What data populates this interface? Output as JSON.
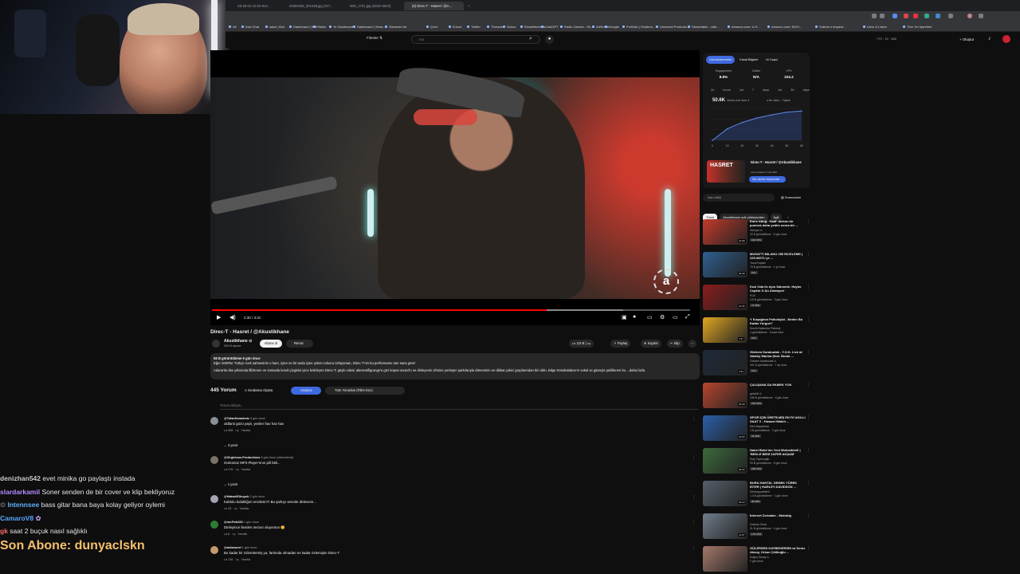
{
  "stream": {
    "chat": [
      {
        "user": "denizhan542",
        "color": "#c8c8c8",
        "msg": "evet minika go paylaştı instada"
      },
      {
        "user": "slardarkamil",
        "color": "#b78cff",
        "msg": "Soner senden de bir cover ve klip bekliyoruz"
      },
      {
        "user": "Intennsee",
        "color": "#5fb0ff",
        "msg": "bass gitar bana baya kolay geliyor oylemi"
      },
      {
        "user": "CamaroV8",
        "color": "#58a6ff",
        "msg": ""
      },
      {
        "user": "gk",
        "color": "#ff6b6b",
        "msg": "saat 2 buçuk nasıl sağlıklı"
      }
    ],
    "last_sub": "Son Abone: dunyaclskn",
    "chat_user_prefix": "⊙"
  },
  "browser": {
    "tabs": [
      {
        "label": "-23-29-02-12-01-813..."
      },
      {
        "label": "20250328_001238.jpg (317..."
      },
      {
        "label": "IMG_1701.jpg (4032×3024)"
      },
      {
        "label": "(6) Direc-T - Hasret / @A..."
      }
    ],
    "bookmarks": [
      "Alt",
      "Kick Chat",
      "sasa | Kick",
      "Dashboard | Kick",
      "Twitch",
      "Ye Dashboard",
      "Dashboard | Strea...",
      "Streamer Ad",
      "Çevri",
      "iCloud",
      "Twitter",
      "Threads",
      "Ücüzu",
      "Einstellements",
      "ChatGPT",
      "Radio Garden - Kh...",
      "AdSense",
      "Google",
      "Portfolio | Shutters...",
      "Universal Products...",
      "Streamable - vide...",
      "Amazon.com: U.S...",
      "Amazon.com: NCIV...",
      "Submit a request...",
      "Drive & Listen",
      "Tüm Yer İşaretleri"
    ]
  },
  "yt": {
    "filters_label": "Filtreler ⇅",
    "search_placeholder": "Ara",
    "create_label": "+ Oluştur",
    "stats": "779 · 15 · 465"
  },
  "video": {
    "title": "Direc-T - Hasret / @Akustikhane",
    "time": "2:30 / 3:31",
    "progress": 0.7,
    "buffered": 0.86,
    "watermark": "a",
    "channel": "Akustikhane ⊙",
    "subs": "390 B abone",
    "subscribe_label": "Abone ol",
    "join_label": "Remix",
    "likes": "3,9 B",
    "share_label": "Paylaş",
    "save_label": "Kaydet",
    "clip_label": "Klip",
    "desc_meta": "58 B görüntüleme  6 gün önce",
    "desc_line1": "Eğer 2000'ler Türkçe rock sahnesinin o ham, içten ve bir anda içine çeken ruhunu özlüyorsan, Direc-T'nin bu performansı tam sana göre!",
    "desc_line2": "Adana'da lise yıllarında filizlenen ve zamanla kendi çizgisini iyice belirleyen Direc-T; güçlü vokal, alternatif/grunge'a göz kırpan sound'u ve dinleyenin zihnine yerleşen şarkılarıyla döneminin en dikkat çekici gruplarından biri oldu. Bilge Kösebalaban'ın vokal ve gitarıyla şekillenen bu ...daha fazla"
  },
  "comments": {
    "count": "445 Yorum",
    "sort_label": "Sıralama ölçütü",
    "analyze_chip": "Analyze",
    "filter_chip": "Tüm Yorumlar (Filtre Enc)",
    "add_placeholder": "Yorum ekleyin...",
    "items": [
      {
        "author": "@TufanKaradeniz",
        "time": "5 gün önce",
        "text": "oldlarsi gözü yaşlı, yeniler hav hav hav",
        "likes": "406",
        "reply": "Yanıtla",
        "replies": "3 yanıt",
        "avatar": "#8a8f98"
      },
      {
        "author": "@Virginious.Productions",
        "time": "5 gün önce (düzenlendi)",
        "text": "Günümüz MP3 Player'ımın pili bitti...",
        "likes": "176",
        "reply": "Yanıtla",
        "replies": "1 yanıt",
        "avatar": "#7a7468"
      },
      {
        "author": "@Hakan5Obuyuk",
        "time": "2 gün önce",
        "text": "Kablolu kulaklığım nerdesin?! Bu şarkıyı senınle dinlecem...",
        "likes": "15",
        "reply": "Yanıtla",
        "replies": "",
        "avatar": "#a4a4b0"
      },
      {
        "author": "@nurFolk301",
        "time": "1 gün önce",
        "text": "Dinleyince liseden mezun oluyorsun 😊",
        "likes": "8",
        "reply": "Yanıtla",
        "replies": "",
        "avatar": "#2e7d32"
      },
      {
        "author": "@ardasunel",
        "time": "1 gün önce",
        "text": "Bu kadar bir özlemlermiş ya, farkında olmadan ne kadar özlemişim Direc-T",
        "likes": "136",
        "reply": "Yanıtla",
        "replies": "",
        "avatar": "#c49a6c"
      }
    ]
  },
  "extension": {
    "tabs": [
      "Görüntülenmeler",
      "Kanal Bilgileri",
      "AI Capsl"
    ],
    "metrics": [
      {
        "label": "Engagement",
        "value": "8.8%"
      },
      {
        "label": "Outlier",
        "value": "N/A"
      },
      {
        "label": "VPH",
        "value": "234.2"
      }
    ],
    "periods": "24 hours 1st 7 days 1st 30 days",
    "big_views": "50.6K",
    "views_over": "Views over time ▾",
    "opts": "● Bu video  ○ Tipikal",
    "thumb_text": "HASRET",
    "video_title": "Direc-T - Hasret / @Akustikhane",
    "video_sub": "Last Updated: 9.04.2025",
    "similar_btn": "See similar thumbnails →",
    "chart_data": {
      "type": "line",
      "x": [
        0,
        10,
        20,
        30,
        40,
        50,
        60
      ],
      "values": [
        0,
        18,
        28,
        35,
        40,
        44,
        46
      ],
      "ylim": [
        0,
        50
      ],
      "xticks": [
        "0",
        "10",
        "20",
        "30",
        "40",
        "50",
        "60"
      ]
    }
  },
  "sidebar": {
    "ask_placeholder": "Ask vidIQ",
    "summarize_label": "Summarize",
    "chips": [
      "Tümü",
      "Akustikhane adlı yükleyiciden",
      "İlgili"
    ],
    "recs": [
      {
        "title": "Emre Altuğ: 'Hadi' derken bir pumruk daha yedim sonra bir ...",
        "channel": "Hürriyet ⊙",
        "meta": "22 B görüntüleme · 5 gün önce",
        "dur": "21:09",
        "badges": [
          "192 VPH"
        ],
        "thumb": "#c43b2c"
      },
      {
        "title": "MUSATTI MILANO 250 İNCELEME | 225.000TL'ye ...",
        "channel": "Yusuf Kaplan",
        "meta": "79 B görüntüleme · 1 yıl önce",
        "dur": "20:49",
        "badges": [
          "0.5x"
        ],
        "thumb": "#2f5f8f"
      },
      {
        "title": "Kızıl Oda ile Aynı Sahnede: Hayko Cepkin O An Anlatıyor!",
        "channel": "FOX",
        "meta": "3,5 B görüntüleme · 3 gün önce",
        "dur": "13:45",
        "badges": [
          "71 VPH"
        ],
        "thumb": "#8a1c1c"
      },
      {
        "title": "Y Kuşağının Psikolojisi - Neden Bu Kadar Yorgun?",
        "channel": "Semih Hakkında Psikoloji",
        "meta": "4 görüntüleme · 6 saat önce",
        "dur": "4:17",
        "badges": [
          "Yeni"
        ],
        "thumb": "#e0a622"
      },
      {
        "title": "Görkem Karabudak - Y.O.K. Live at Ataköy Marina (feat. Burak ...",
        "channel": "Görkem Karabudak ⊙",
        "meta": "441 B görüntüleme · 7 ay önce",
        "dur": "4:43",
        "badges": [
          "0.2x"
        ],
        "thumb": "#1e2a3a"
      },
      {
        "title": "ÇALIŞANA DA EKMEK YOK",
        "channel": "gokshtf ⊙",
        "meta": "196 B görüntüleme · 3 gün önce",
        "dur": "23:28",
        "badges": [
          "378 VPH"
        ],
        "thumb": "#b7462f"
      },
      {
        "title": "SPOR İÇİN ÜRETİLMİŞ EN İYİ AKILLI SAAT !! - Huawei Watch ...",
        "channel": "Mert Başaranlar",
        "meta": "3 B görüntüleme · 2 gün önce",
        "dur": "19:50",
        "badges": [
          "79 VPH"
        ],
        "thumb": "#2b5fa8"
      },
      {
        "title": "Nabel Bebe'nin Yeni Motosikleti! | 'BEKLE BENİ ZAFER AKŞAM'",
        "channel": "Eray Topkoroğlu",
        "meta": "93 B görüntüleme · 5 gün önce",
        "dur": "26:43",
        "badges": [
          "195 VPH"
        ],
        "thumb": "#3c6a3c"
      },
      {
        "title": "BURA HANTAL DEMEK YÜREK İSTER | HARLEY-DAVIDSON ...",
        "channel": "Mechapparkeleri",
        "meta": "1,4 B görüntüleme · 1 gün önce",
        "dur": "18:10",
        "badges": [
          "45 VPH"
        ],
        "thumb": "#55606a"
      },
      {
        "title": "İnternet Zorbaları - Motobig",
        "channel": "Gokhan Greer",
        "meta": "21 B görüntüleme · 4 gün önce",
        "dur": "14:07",
        "badges": [
          "175 VPH"
        ],
        "thumb": "#6f7c8a"
      },
      {
        "title": "GÜLERSEN KAYBEDERSİN w/ Deniz Aksoy, Orkun Çelikoğlu ...",
        "channel": "Doğuş Savaş ⊙",
        "meta": "2 gün önce",
        "dur": "",
        "badges": [],
        "thumb": "#a4786a"
      }
    ]
  }
}
